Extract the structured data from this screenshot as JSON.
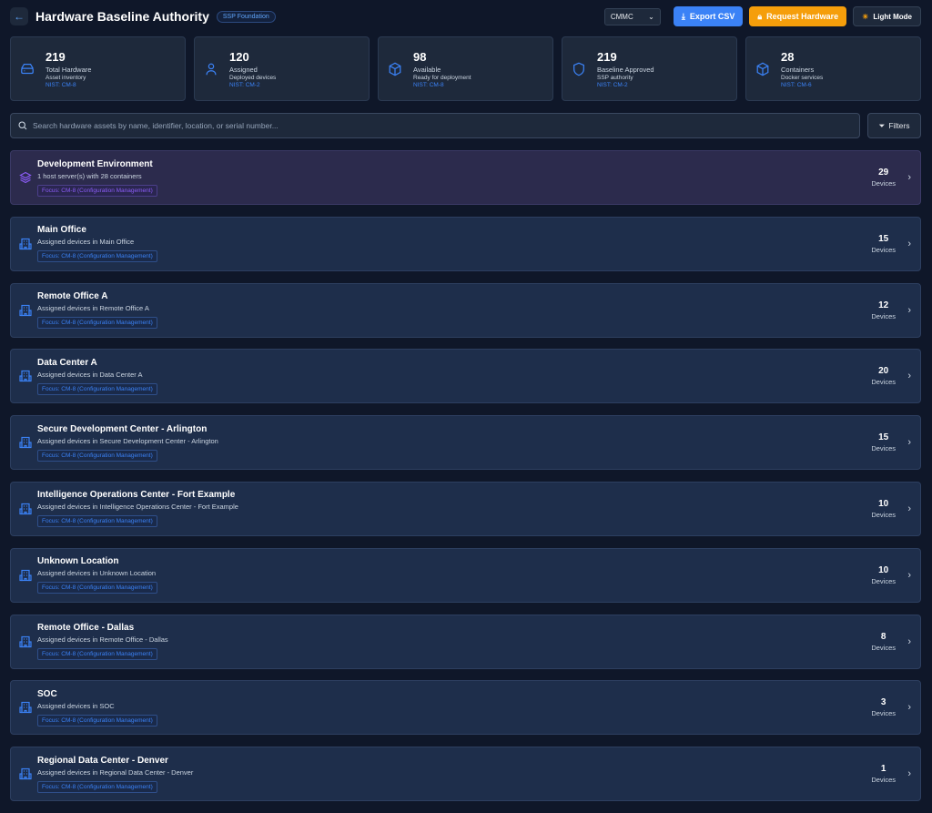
{
  "header": {
    "title": "Hardware Baseline Authority",
    "badge": "SSP Foundation",
    "framework": "CMMC",
    "export": "Export CSV",
    "request": "Request Hardware",
    "theme": "Light Mode"
  },
  "stats": [
    {
      "value": "219",
      "label": "Total Hardware",
      "sub": "Asset inventory",
      "nist": "NIST: CM-8",
      "icon": "hard-drive-icon"
    },
    {
      "value": "120",
      "label": "Assigned",
      "sub": "Deployed devices",
      "nist": "NIST: CM-2",
      "icon": "user-icon"
    },
    {
      "value": "98",
      "label": "Available",
      "sub": "Ready for deployment",
      "nist": "NIST: CM-8",
      "icon": "package-icon"
    },
    {
      "value": "219",
      "label": "Baseline Approved",
      "sub": "SSP authority",
      "nist": "NIST: CM-2",
      "icon": "shield-icon"
    },
    {
      "value": "28",
      "label": "Containers",
      "sub": "Docker services",
      "nist": "NIST: CM-6",
      "icon": "box-icon"
    }
  ],
  "search": {
    "placeholder": "Search hardware assets by name, identifier, location, or serial number...",
    "filters": "Filters"
  },
  "groups": [
    {
      "name": "Development Environment",
      "desc": "1 host server(s) with 28 containers",
      "focus": "Focus: CM-8 (Configuration Management)",
      "count": "29",
      "unit": "Devices",
      "dev": true
    },
    {
      "name": "Main Office",
      "desc": "Assigned devices in Main Office",
      "focus": "Focus: CM-8 (Configuration Management)",
      "count": "15",
      "unit": "Devices"
    },
    {
      "name": "Remote Office A",
      "desc": "Assigned devices in Remote Office A",
      "focus": "Focus: CM-8 (Configuration Management)",
      "count": "12",
      "unit": "Devices"
    },
    {
      "name": "Data Center A",
      "desc": "Assigned devices in Data Center A",
      "focus": "Focus: CM-8 (Configuration Management)",
      "count": "20",
      "unit": "Devices"
    },
    {
      "name": "Secure Development Center - Arlington",
      "desc": "Assigned devices in Secure Development Center - Arlington",
      "focus": "Focus: CM-8 (Configuration Management)",
      "count": "15",
      "unit": "Devices"
    },
    {
      "name": "Intelligence Operations Center - Fort Example",
      "desc": "Assigned devices in Intelligence Operations Center - Fort Example",
      "focus": "Focus: CM-8 (Configuration Management)",
      "count": "10",
      "unit": "Devices"
    },
    {
      "name": "Unknown Location",
      "desc": "Assigned devices in Unknown Location",
      "focus": "Focus: CM-8 (Configuration Management)",
      "count": "10",
      "unit": "Devices"
    },
    {
      "name": "Remote Office - Dallas",
      "desc": "Assigned devices in Remote Office - Dallas",
      "focus": "Focus: CM-8 (Configuration Management)",
      "count": "8",
      "unit": "Devices"
    },
    {
      "name": "SOC",
      "desc": "Assigned devices in SOC",
      "focus": "Focus: CM-8 (Configuration Management)",
      "count": "3",
      "unit": "Devices"
    },
    {
      "name": "Regional Data Center - Denver",
      "desc": "Assigned devices in Regional Data Center - Denver",
      "focus": "Focus: CM-8 (Configuration Management)",
      "count": "1",
      "unit": "Devices"
    }
  ]
}
